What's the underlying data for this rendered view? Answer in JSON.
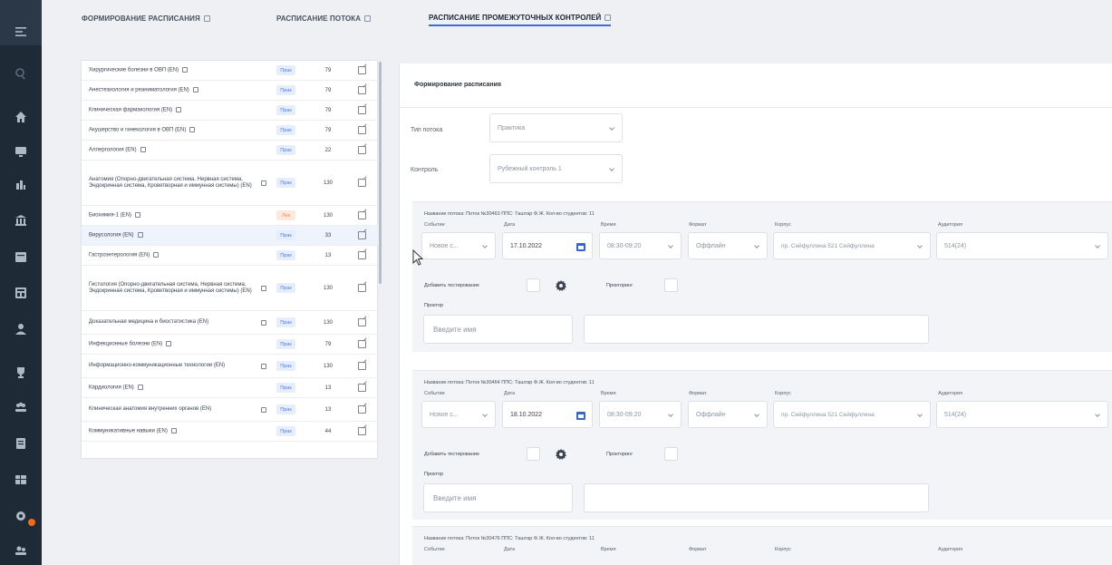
{
  "tabs": [
    {
      "label": "ФОРМИРОВАНИЕ РАСПИСАНИЯ",
      "active": false
    },
    {
      "label": "РАСПИСАНИЕ ПОТОКА",
      "active": false
    },
    {
      "label": "РАСПИСАНИЕ ПРОМЕЖУТОЧНЫХ КОНТРОЛЕЙ",
      "active": true
    }
  ],
  "disciplines": [
    {
      "name": "Хирургические болезни в ОВП (EN)",
      "type": "Прак",
      "count": "79"
    },
    {
      "name": "Анестезиология и реаниматология (EN)",
      "type": "Прак",
      "count": "79"
    },
    {
      "name": "Клиническая фармакология (EN)",
      "type": "Прак",
      "count": "79"
    },
    {
      "name": "Акушерство и гинекология в ОВП (EN)",
      "type": "Прак",
      "count": "79"
    },
    {
      "name": "Аллергология (EN)",
      "type": "Прак",
      "count": "22"
    },
    {
      "name": "Анатомия (Опорно-двигательная система, Нервная система, Эндокринная система, Кроветворная и иммунная системы) (EN)",
      "type": "Прак",
      "count": "130"
    },
    {
      "name": "Биохимия-1 (EN)",
      "type": "Лек",
      "count": "130"
    },
    {
      "name": "Вирусология (EN)",
      "type": "Прак",
      "count": "33"
    },
    {
      "name": "Гастроэнтерология (EN)",
      "type": "Прак",
      "count": "13"
    },
    {
      "name": "Гистология (Опорно-двигательная система, Нервная система, Эндокринная система, Кроветворная и иммунная системы) (EN)",
      "type": "Прак",
      "count": "130"
    },
    {
      "name": "Доказательная медицина и биостатистика (EN)",
      "type": "Прак",
      "count": "130"
    },
    {
      "name": "Инфекционные болезни (EN)",
      "type": "Прак",
      "count": "79"
    },
    {
      "name": "Информационно-коммуникационные технологии (EN)",
      "type": "Прак",
      "count": "130"
    },
    {
      "name": "Кардиология (EN)",
      "type": "Прак",
      "count": "13"
    },
    {
      "name": "Клиническая анатомия внутренних органов (EN)",
      "type": "Прак",
      "count": "13"
    },
    {
      "name": "Коммуникативные навыки (EN)",
      "type": "Прак",
      "count": "44"
    }
  ],
  "main": {
    "title": "Формирование расписания",
    "stream_type_label": "Тип потока",
    "stream_type_value": "Практика",
    "control_label": "Контроль",
    "control_value": "Рубежный контроль 1"
  },
  "field_labels": {
    "event": "Событие",
    "date": "Дата",
    "time": "Время",
    "format": "Формат",
    "building": "Корпус",
    "room": "Аудитория",
    "add_testing": "Добавить тестирование",
    "proctoring": "Прокторинг",
    "proctor": "Проктор",
    "proctor_placeholder": "Введите имя"
  },
  "cards": [
    {
      "header": "Название потока: Поток №30463    ППС: Таштар Ф.Ж.    Кол-во студентов: 11",
      "event": "Новое с...",
      "date": "17.10.2022",
      "time": "08:30-09:20",
      "format": "Оффлайн",
      "building": "пр. Сейфуллина 521 Сейфуллина",
      "room": "514(24)"
    },
    {
      "header": "Название потока: Поток №30464    ППС: Таштар Ф.Ж.    Кол-во студентов: 11",
      "event": "Новое с...",
      "date": "18.10.2022",
      "time": "08:30-09:20",
      "format": "Оффлайн",
      "building": "пр. Сейфуллина 521 Сейфуллина",
      "room": "514(24)"
    },
    {
      "header": "Название потока: Поток №30476    ППС: Таштар Ф.Ж.    Кол-во студентов: 11"
    }
  ],
  "colors": {
    "accent": "#3a6fd6",
    "rail": "#1f2a37",
    "notification": "#f06a1c"
  }
}
